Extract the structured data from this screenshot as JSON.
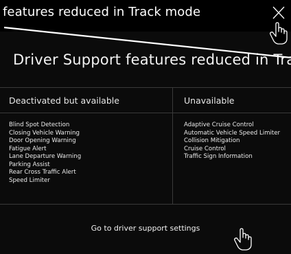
{
  "header": {
    "title": "features reduced in Track mode"
  },
  "panel": {
    "title": "Driver Support features reduced in Track",
    "columns": [
      {
        "heading": "Deactivated but available",
        "items": [
          "Blind Spot Detection",
          "Closing Vehicle Warning",
          "Door Opening Warning",
          "Fatigue Alert",
          "Lane Departure Warning",
          "Parking Assist",
          "Rear Cross Traffic Alert",
          "Speed Limiter"
        ]
      },
      {
        "heading": "Unavailable",
        "items": [
          "Adaptive Cruise Control",
          "Automatic Vehicle Speed Limiter",
          "Collision Mitigation",
          "Cruise Control",
          "Traffic Sign Information"
        ]
      }
    ],
    "settings_link": "Go to driver support settings"
  },
  "icons": {
    "close": "close-icon",
    "pointer": "hand-pointer-icon"
  },
  "colors": {
    "background": "#000000",
    "panel": "#0b0b0b",
    "divider": "#3a3a3a",
    "text": "#ffffff"
  }
}
